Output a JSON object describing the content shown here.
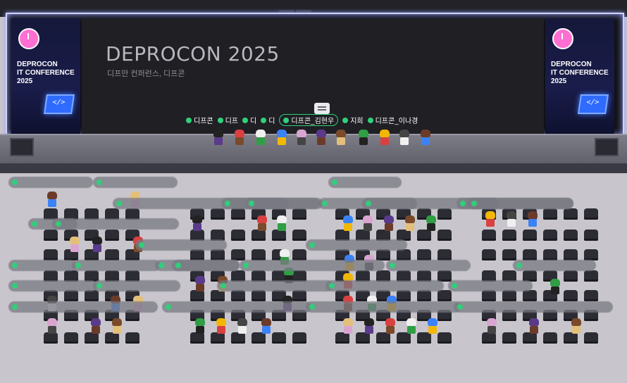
{
  "event": {
    "title": "DEPROCON 2025",
    "subtitle": "디프만 컨퍼런스, 디프콘",
    "banner_left": "DEPROCON\nIT CONFERENCE\n2025",
    "banner_right": "DEPROCON\nIT CONFERENCE\n2025",
    "laptop_glyph": "</>"
  },
  "stage_tags": [
    {
      "label": "디프콘",
      "highlight": false
    },
    {
      "label": "디프",
      "highlight": false
    },
    {
      "label": "디",
      "highlight": false
    },
    {
      "label": "디",
      "highlight": false
    },
    {
      "label": "디프콘_김현우",
      "highlight": true
    },
    {
      "label": "지희",
      "highlight": false
    },
    {
      "label": "디프콘_이나경",
      "highlight": false
    }
  ],
  "colors": {
    "presence_dot": "#2fd07a",
    "screen_glow": "#cfd2ff",
    "floor": "#c8c6cc"
  }
}
